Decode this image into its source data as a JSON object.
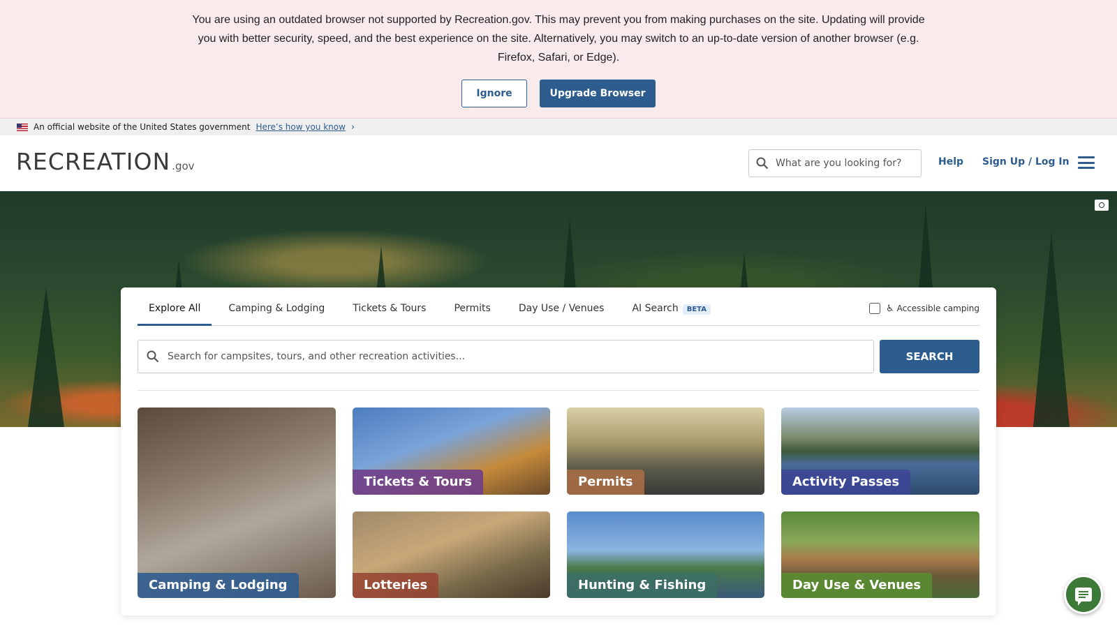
{
  "browser_banner": {
    "message": "You are using an outdated browser not supported by Recreation.gov. This may prevent you from making purchases on the site. Updating will provide you with better security, speed, and the best experience on the site. Alternatively, you may switch to an up-to-date version of another browser (e.g. Firefox, Safari, or Edge).",
    "ignore_label": "Ignore",
    "upgrade_label": "Upgrade Browser"
  },
  "gov_banner": {
    "text": "An official website of the United States government",
    "link": "Here’s how you know",
    "icon": "flag-icon"
  },
  "header": {
    "logo_main": "RECREATION",
    "logo_gov": ".gov",
    "search_placeholder": "What are you looking for?",
    "help_label": "Help",
    "login_label": "Sign Up / Log In",
    "menu_icon": "hamburger-icon"
  },
  "tabs": [
    {
      "label": "Explore All",
      "active": true
    },
    {
      "label": "Camping & Lodging"
    },
    {
      "label": "Tickets & Tours"
    },
    {
      "label": "Permits"
    },
    {
      "label": "Day Use / Venues"
    },
    {
      "label": "AI Search",
      "badge": "BETA"
    }
  ],
  "accessible_label": "Accessible camping",
  "main_search": {
    "placeholder": "Search for campsites, tours, and other recreation activities...",
    "button": "SEARCH"
  },
  "tiles": {
    "camping": "Camping & Lodging",
    "tickets": "Tickets & Tours",
    "permits": "Permits",
    "passes": "Activity Passes",
    "lotteries": "Lotteries",
    "hunting": "Hunting & Fishing",
    "dayuse": "Day Use & Venues"
  },
  "colors": {
    "primary": "#2d5c8f",
    "banner_bg": "#f9ebeb",
    "chat": "#3d7a3a"
  }
}
